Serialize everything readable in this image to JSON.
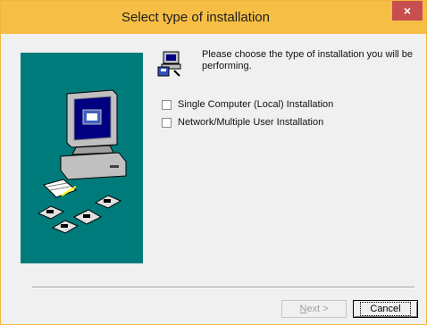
{
  "window": {
    "title": "Select type of installation",
    "close_glyph": "×",
    "accent_color": "#f6be45",
    "close_color": "#c74f50"
  },
  "side_panel": {
    "background": "#007b7b",
    "illustration": "computer-with-disks"
  },
  "prompt": {
    "icon": "setup-computer-icon",
    "text": "Please choose the type of installation you will be performing."
  },
  "options": [
    {
      "label": "Single Computer (Local) Installation",
      "checked": false
    },
    {
      "label": "Network/Multiple User Installation",
      "checked": false
    }
  ],
  "buttons": {
    "next_mnemonic": "N",
    "next_rest": "ext >",
    "next_enabled": false,
    "cancel_label": "Cancel"
  }
}
